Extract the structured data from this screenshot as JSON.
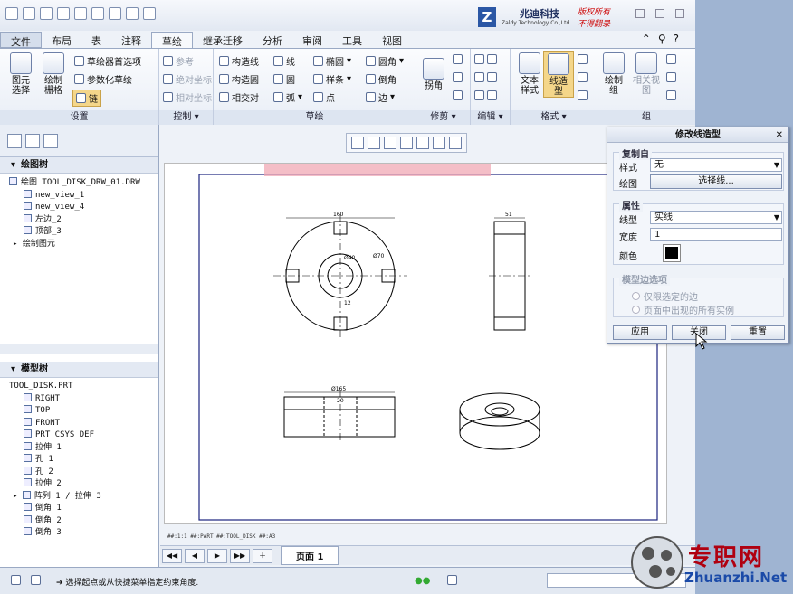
{
  "logo": {
    "mark": "Z",
    "company_cn": "兆迪科技",
    "company_en": "Zaldy Technology Co.,Ltd.",
    "notice_line1": "版权所有",
    "notice_line2": "不得翻录"
  },
  "tabs": [
    "文件",
    "布局",
    "表",
    "注释",
    "草绘",
    "继承迁移",
    "分析",
    "审阅",
    "工具",
    "视图"
  ],
  "ribbon": {
    "setup": {
      "label": "设置",
      "select": "图元\n选择",
      "grid": "绘制\n栅格",
      "prefs": "草绘器首选项",
      "param": "参数化草绘",
      "chain": "链"
    },
    "control": {
      "label": "控制",
      "ref": "参考",
      "abs": "绝对坐标",
      "rel": "相对坐标"
    },
    "sketch": {
      "label": "草绘",
      "items": [
        "构造线",
        "线",
        "椭圆",
        "圆角",
        "构造圆",
        "圆",
        "样条",
        "倒角",
        "相交对",
        "弧",
        "点",
        "边"
      ]
    },
    "trim": {
      "label": "修剪",
      "corner": "拐角"
    },
    "edit": {
      "label": "编辑"
    },
    "format": {
      "label": "格式",
      "text": "文本\n样式",
      "linestyle": "线造\n型"
    },
    "group": {
      "label": "组",
      "draw_group": "绘制\n组",
      "related_view": "相关视\n图"
    }
  },
  "drawing_tree": {
    "title": "绘图树",
    "items": [
      "绘图 TOOL_DISK_DRW_01.DRW",
      "new_view_1",
      "new_view_4",
      "左边_2",
      "顶部_3",
      "绘制图元"
    ]
  },
  "model_tree": {
    "title": "模型树",
    "items": [
      "TOOL_DISK.PRT",
      "RIGHT",
      "TOP",
      "FRONT",
      "PRT_CSYS_DEF",
      "拉伸 1",
      "孔 1",
      "孔 2",
      "拉伸 2",
      "阵列 1 / 拉伸 3",
      "倒角 1",
      "倒角 2",
      "倒角 3"
    ]
  },
  "drawing": {
    "dims": [
      "160",
      "51",
      "Ø40",
      "Ø70",
      "12",
      "Ø165",
      "20"
    ],
    "sheet_info": "##:1:1     ##:PART   ##:TOOL_DISK   ##:A3"
  },
  "page_label": "页面 1",
  "status_text": "选择起点或从快捷菜单指定约束角度.",
  "dialog": {
    "title": "修改线造型",
    "copy_from": "复制自",
    "style_label": "样式",
    "style_value": "无",
    "drawing_label": "绘图",
    "select_line": "选择线...",
    "props": "属性",
    "linetype_label": "线型",
    "linetype_value": "实线",
    "width_label": "宽度",
    "width_value": "1",
    "color_label": "颜色",
    "color_value": "#000000",
    "edge_opts": "模型边选项",
    "opt1": "仅限选定的边",
    "opt2": "页面中出现的所有实例",
    "apply": "应用",
    "close": "关闭",
    "reset": "重置"
  },
  "watermark": {
    "cn": "专职网",
    "url": "Zhuanzhi.Net"
  }
}
